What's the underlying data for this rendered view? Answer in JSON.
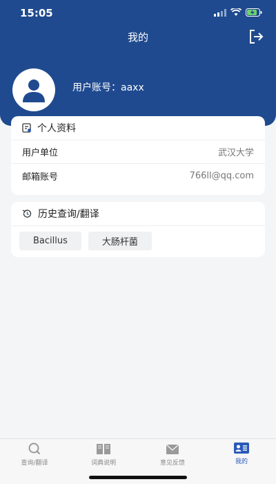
{
  "status_bar": {
    "time": "15:05"
  },
  "header": {
    "title": "我的"
  },
  "profile": {
    "account_label": "用户账号：",
    "account_value": "aaxx"
  },
  "personal_info": {
    "title": "个人资料",
    "rows": [
      {
        "label": "用户单位",
        "value": "武汉大学"
      },
      {
        "label": "邮箱账号",
        "value": "766ll@qq.com"
      }
    ]
  },
  "history": {
    "title": "历史查询/翻译",
    "items": [
      "Bacillus",
      "大肠杆菌"
    ]
  },
  "tabbar": {
    "tabs": [
      {
        "label": "查询/翻译",
        "icon": "search-icon"
      },
      {
        "label": "词典说明",
        "icon": "book-icon"
      },
      {
        "label": "意见反馈",
        "icon": "feedback-icon"
      },
      {
        "label": "我的",
        "icon": "profile-card-icon"
      }
    ],
    "active_index": 3
  },
  "colors": {
    "header_bg": "#1f4a8f",
    "accent": "#2a5ab8",
    "page_bg": "#f4f5f7"
  }
}
